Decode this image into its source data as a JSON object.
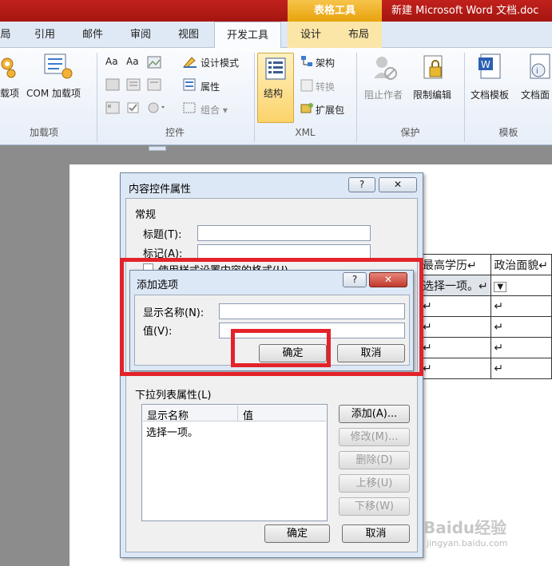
{
  "window": {
    "context_group": "表格工具",
    "doc_title": "新建 Microsoft Word 文档.doc"
  },
  "tabs": [
    {
      "label": "局",
      "active": false
    },
    {
      "label": "引用",
      "active": false
    },
    {
      "label": "邮件",
      "active": false
    },
    {
      "label": "审阅",
      "active": false
    },
    {
      "label": "视图",
      "active": false
    },
    {
      "label": "开发工具",
      "active": true
    },
    {
      "label": "设计",
      "active": false
    },
    {
      "label": "布局",
      "active": false
    }
  ],
  "ribbon": {
    "addins": {
      "label": "加载项",
      "btn1": "载项",
      "btn2": "COM 加载项"
    },
    "controls": {
      "label": "控件",
      "design_mode": "设计模式",
      "properties": "属性",
      "group": "组合 ▾"
    },
    "xml": {
      "label": "XML",
      "structure": "结构",
      "schema": "架构",
      "transform": "转换",
      "expansion": "扩展包"
    },
    "protect": {
      "label": "保护",
      "block_authors": "阻止作者",
      "restrict_edit": "限制编辑"
    },
    "templates": {
      "label": "模板",
      "doc_template": "文档模板",
      "doc_info": "文档面"
    }
  },
  "table": {
    "headers": [
      "最高学历↵",
      "政治面貌↵"
    ],
    "row1": [
      "选择一项。↵",
      "▼"
    ],
    "cell_mark": "↵"
  },
  "props_dialog": {
    "title": "内容控件属性",
    "help": "?",
    "close": "✕",
    "general": "常规",
    "title_label": "标题(T):",
    "tag_label": "标记(A):",
    "style_checkbox": "使用样式设置内容的格式(U)",
    "dropdown_props": "下拉列表属性(L)",
    "list": {
      "col_display": "显示名称",
      "col_value": "值",
      "items": [
        "选择一项。"
      ]
    },
    "buttons": {
      "add": "添加(A)...",
      "modify": "修改(M)...",
      "delete": "删除(D)",
      "up": "上移(U)",
      "down": "下移(W)"
    },
    "ok": "确定",
    "cancel": "取消"
  },
  "add_dialog": {
    "title": "添加选项",
    "help": "?",
    "close": "✕",
    "display_label": "显示名称(N):",
    "value_label": "值(V):",
    "display_value": "",
    "value_value": "",
    "ok": "确定",
    "cancel": "取消"
  },
  "watermark": {
    "brand": "Baidu经验",
    "url": "jingyan.baidu.com"
  },
  "colors": {
    "title_red": "#c1211d",
    "highlight": "#e3222a",
    "context_gold": "#f0b42a"
  }
}
